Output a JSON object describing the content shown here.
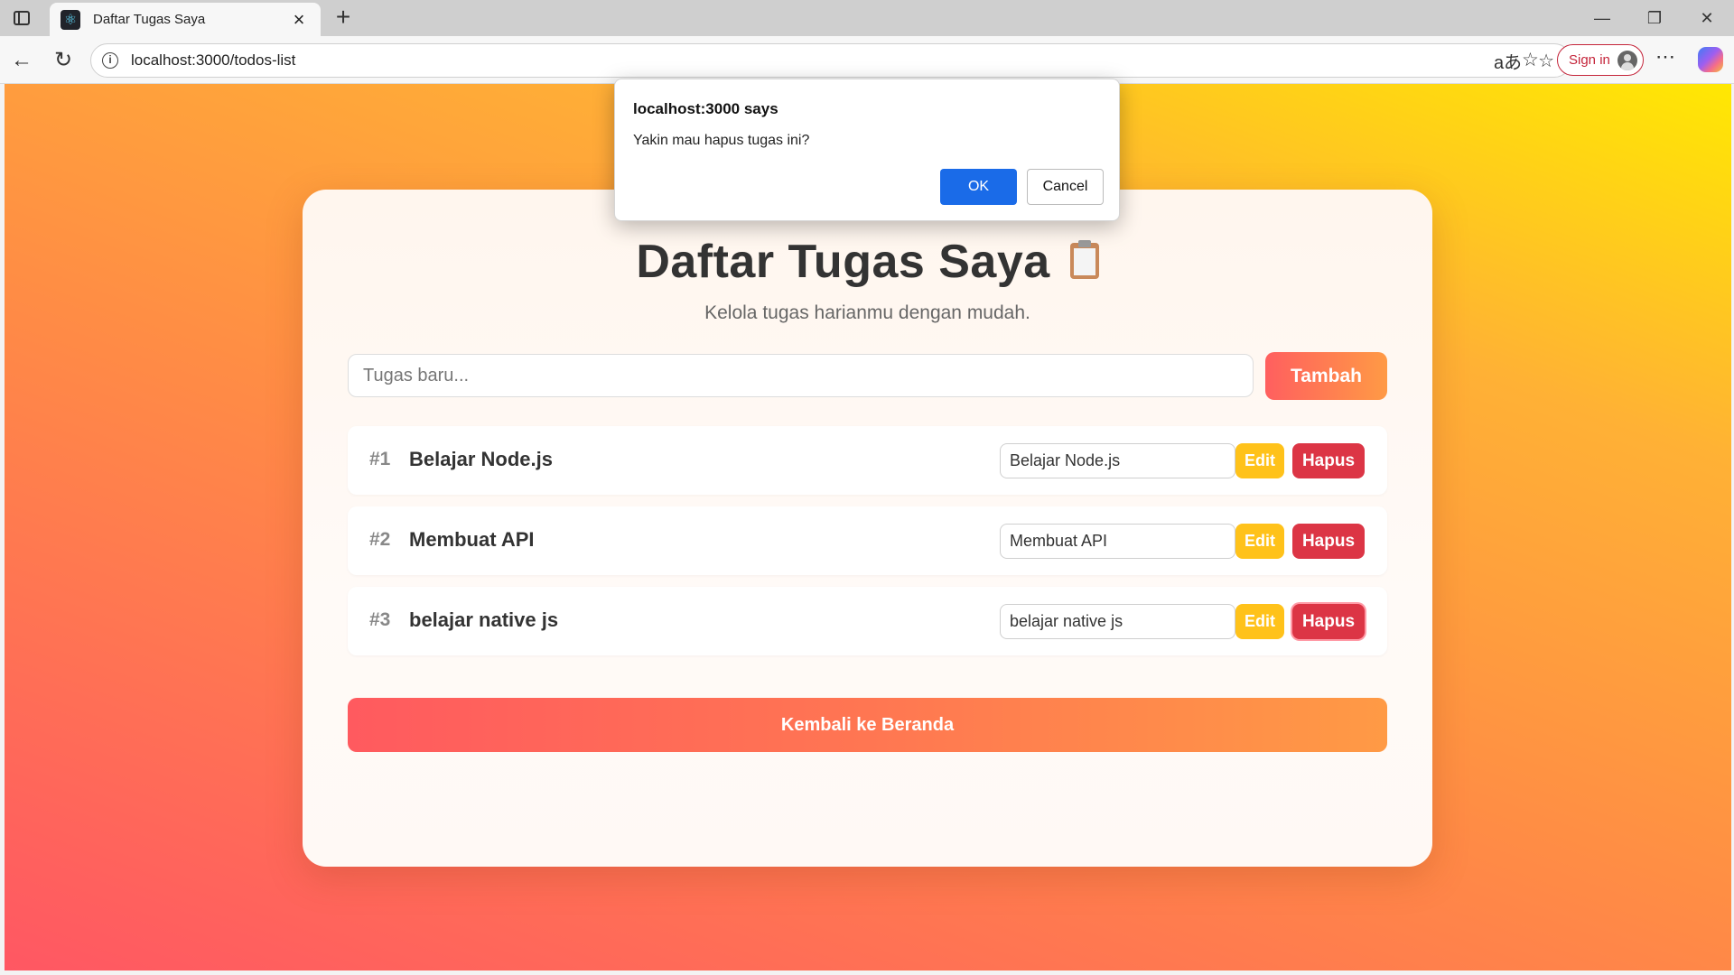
{
  "browser": {
    "tab_title": "Daftar Tugas Saya",
    "url": "localhost:3000/todos-list",
    "signin_label": "Sign in",
    "icons": {
      "favicon": "react-icon",
      "tab_close": "close-icon",
      "new_tab": "plus-icon",
      "back": "back-arrow-icon",
      "reload": "reload-icon",
      "site_info": "info-icon",
      "read_aloud": "read-aloud-icon",
      "favorite": "star-icon",
      "favorites_bar": "favorites-icon",
      "more": "more-icon",
      "copilot": "copilot-icon"
    }
  },
  "dialog": {
    "title": "localhost:3000 says",
    "message": "Yakin mau hapus tugas ini?",
    "ok_label": "OK",
    "cancel_label": "Cancel"
  },
  "page": {
    "title": "Daftar Tugas Saya",
    "subtitle": "Kelola tugas harianmu dengan mudah.",
    "new_task_placeholder": "Tugas baru...",
    "add_label": "Tambah",
    "back_label": "Kembali ke Beranda",
    "todos": [
      {
        "num": "#1",
        "text": "Belajar Node.js",
        "edit_value": "Belajar Node.js",
        "edit_label": "Edit",
        "delete_label": "Hapus"
      },
      {
        "num": "#2",
        "text": "Membuat API",
        "edit_value": "Membuat API",
        "edit_label": "Edit",
        "delete_label": "Hapus"
      },
      {
        "num": "#3",
        "text": "belajar native js",
        "edit_value": "belajar native js",
        "edit_label": "Edit",
        "delete_label": "Hapus"
      }
    ]
  },
  "colors": {
    "accent_gradient_start": "#ff5f5f",
    "accent_gradient_end": "#ff9a45",
    "edit_button": "#ffc21a",
    "delete_button": "#dc3545",
    "dialog_ok": "#1a6be8"
  }
}
